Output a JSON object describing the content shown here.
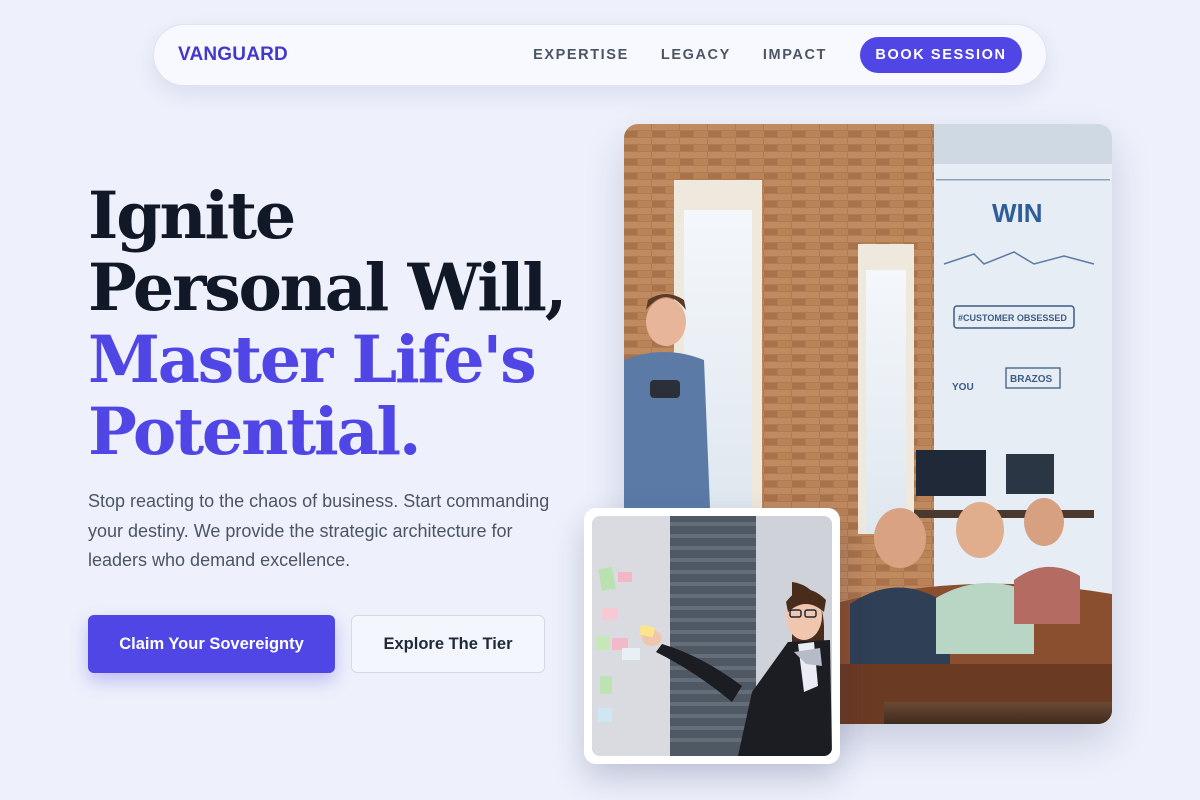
{
  "nav": {
    "brand": "VANGUARD",
    "links": [
      {
        "label": "EXPERTISE"
      },
      {
        "label": "LEGACY"
      },
      {
        "label": "IMPACT"
      }
    ],
    "cta_label": "BOOK SESSION"
  },
  "hero": {
    "headline_line1": "Ignite",
    "headline_line2": "Personal Will,",
    "headline_line3": "Master Life's",
    "headline_line4": "Potential.",
    "lead": "Stop reacting to the chaos of business. Start commanding your destiny. We provide the strategic architecture for leaders who demand excellence.",
    "primary_cta": "Claim Your Sovereignty",
    "secondary_cta": "Explore The Tier"
  },
  "images": {
    "main_photo_subject": "office-presentation-photo",
    "inset_photo_subject": "sticky-notes-planning-photo",
    "mural_text_win": "WIN",
    "mural_text_tag": "#CUSTOMER OBSESSED",
    "mural_text_brazos": "BRAZOS",
    "mural_text_you": "YOU"
  },
  "colors": {
    "accent": "#4f46e5",
    "brand": "#4338ca",
    "background": "#eef1fb",
    "heading": "#111827"
  }
}
